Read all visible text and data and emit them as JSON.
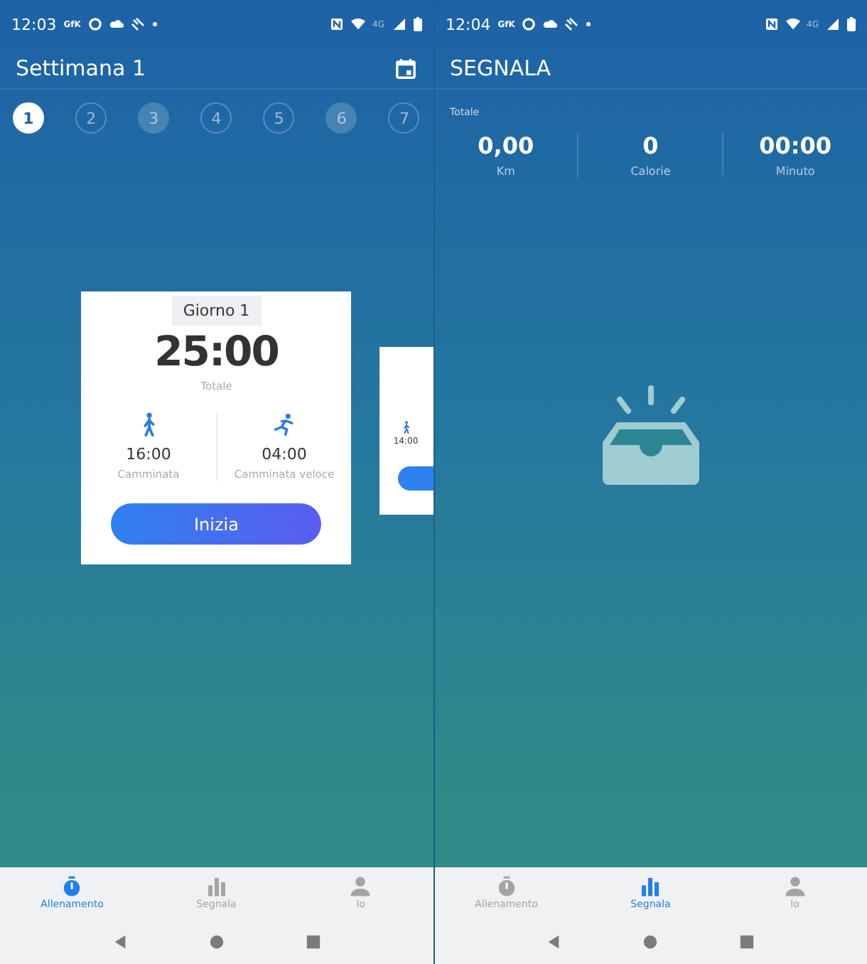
{
  "screens": [
    {
      "kind": "training",
      "status_bar": {
        "time": "12:03",
        "badge": "GfK",
        "network": "4G"
      },
      "title": "Settimana 1",
      "days": [
        {
          "label": "1",
          "selected": true,
          "done": false
        },
        {
          "label": "2",
          "selected": false,
          "done": false
        },
        {
          "label": "3",
          "selected": false,
          "done": true
        },
        {
          "label": "4",
          "selected": false,
          "done": false
        },
        {
          "label": "5",
          "selected": false,
          "done": false
        },
        {
          "label": "6",
          "selected": false,
          "done": true
        },
        {
          "label": "7",
          "selected": false,
          "done": false
        }
      ],
      "day_card": {
        "day": "Giorno 1",
        "total": "25:00",
        "total_label": "Totale",
        "segments": [
          {
            "kind": "walk",
            "time": "16:00",
            "label": "Camminata"
          },
          {
            "kind": "run",
            "time": "04:00",
            "label": "Camminata veloce"
          }
        ],
        "button": "Inizia"
      },
      "next_card": {
        "kind": "walk",
        "time": "14:00"
      },
      "nav": [
        {
          "kind": "stopwatch",
          "label": "Allenamento",
          "selected": true
        },
        {
          "kind": "chart",
          "label": "Segnala",
          "selected": false
        },
        {
          "kind": "person",
          "label": "Io",
          "selected": false
        }
      ]
    },
    {
      "kind": "report",
      "status_bar": {
        "time": "12:04",
        "badge": "GfK",
        "network": "4G"
      },
      "title": "SEGNALA",
      "totals_label": "Totale",
      "stats": [
        {
          "value": "0,00",
          "label": "Km"
        },
        {
          "value": "0",
          "label": "Calorie"
        },
        {
          "value": "00:00",
          "label": "Minuto"
        }
      ],
      "nav": [
        {
          "kind": "stopwatch",
          "label": "Allenamento",
          "selected": false
        },
        {
          "kind": "chart",
          "label": "Segnala",
          "selected": true
        },
        {
          "kind": "person",
          "label": "Io",
          "selected": false
        }
      ]
    }
  ]
}
